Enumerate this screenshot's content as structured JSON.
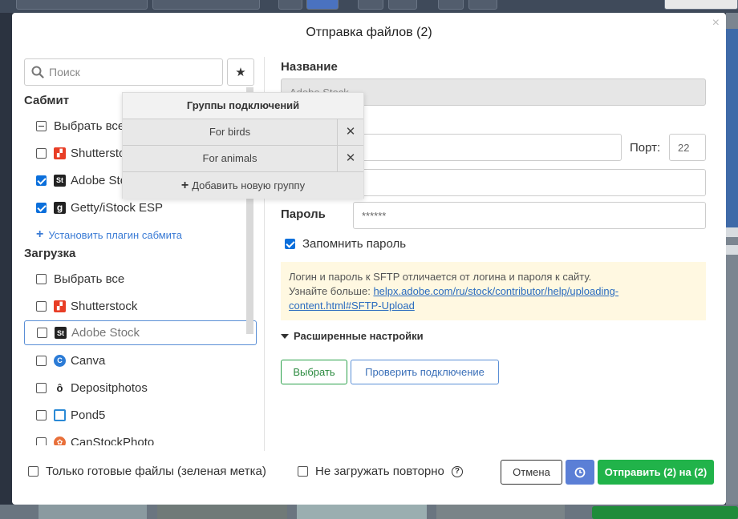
{
  "dialog": {
    "title": "Отправка файлов (2)"
  },
  "search": {
    "placeholder": "Поиск"
  },
  "submit_section": {
    "title": "Сабмит",
    "select_all": "Выбрать все",
    "items": [
      {
        "label": "Shutterstock",
        "checked": false,
        "icon": "shutterstock-icon",
        "color": "#e83e26"
      },
      {
        "label": "Adobe Stock",
        "checked": true,
        "icon": "adobe-stock-icon",
        "color": "#222222"
      },
      {
        "label": "Getty/iStock ESP",
        "checked": true,
        "icon": "getty-icon",
        "color": "#222222"
      }
    ],
    "install_plugin": "Установить плагин сабмита"
  },
  "upload_section": {
    "title": "Загрузка",
    "select_all": "Выбрать все",
    "items": [
      {
        "label": "Shutterstock",
        "icon": "shutterstock-icon",
        "color": "#e83e26"
      },
      {
        "label": "Adobe Stock",
        "icon": "adobe-stock-icon",
        "color": "#222222",
        "selected": true
      },
      {
        "label": "Canva",
        "icon": "canva-icon",
        "color": "#2b7bd6"
      },
      {
        "label": "Depositphotos",
        "icon": "depositphotos-icon",
        "color": "#222222"
      },
      {
        "label": "Pond5",
        "icon": "pond5-icon",
        "color": "#2b8ad6"
      },
      {
        "label": "CanStockPhoto",
        "icon": "canstockphoto-icon",
        "color": "#e8703a"
      }
    ]
  },
  "groups_popup": {
    "title": "Группы подключений",
    "items": [
      "For birds",
      "For animals"
    ],
    "add_label": "Добавить новую группу"
  },
  "form": {
    "name_label": "Название",
    "name_value": "Adobe Stock",
    "port_label": "Порт:",
    "port_value": "22",
    "password_label": "Пароль",
    "password_value": "******",
    "remember_label": "Запомнить пароль",
    "info_text": "Логин и пароль к SFTP отличается от логина и пароля к сайту.",
    "info_more": "Узнайте больше: ",
    "info_link": "helpx.adobe.com/ru/stock/contributor/help/uploading-content.html#SFTP-Upload",
    "advanced_label": "Расширенные настройки",
    "choose_button": "Выбрать",
    "check_button": "Проверить подключение"
  },
  "footer": {
    "only_ready": "Только готовые файлы (зеленая метка)",
    "no_reupload": "Не загружать повторно",
    "cancel": "Отмена",
    "send": "Отправить (2) на (2)"
  },
  "colors": {
    "accent_green": "#21b34a",
    "accent_blue": "#5b7fd6",
    "checkbox_blue": "#0b6fdb"
  }
}
